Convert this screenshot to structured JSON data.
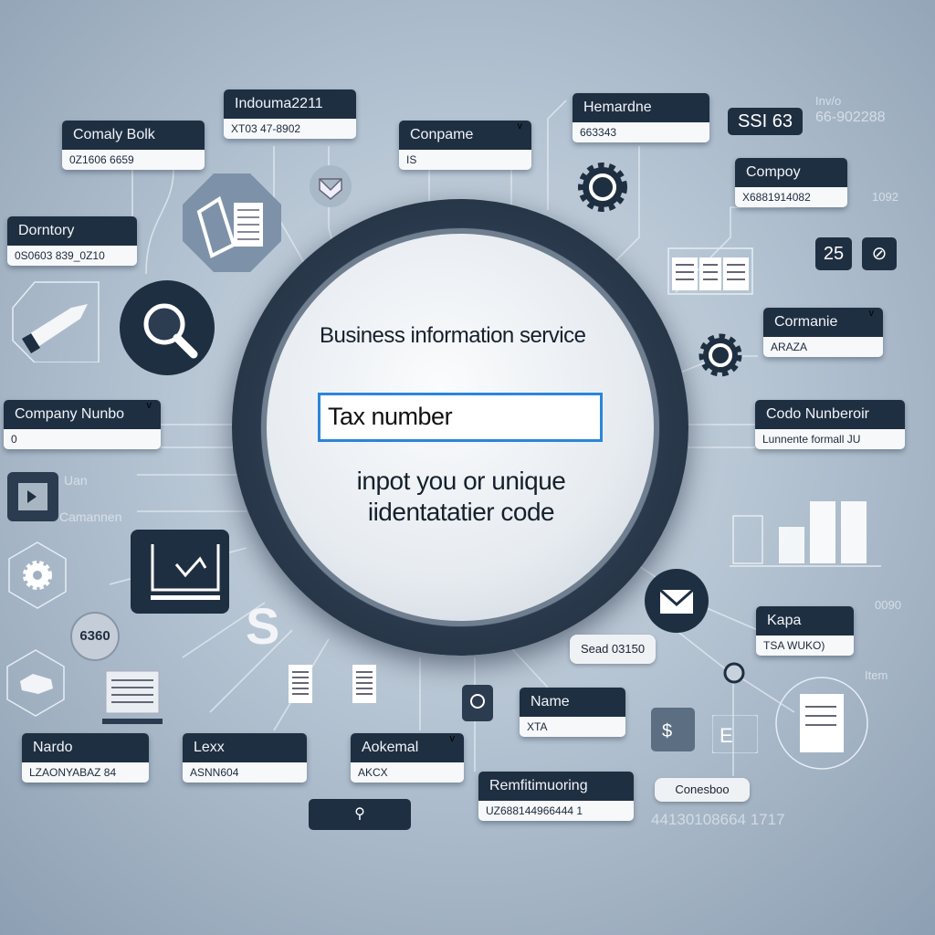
{
  "main": {
    "title": "Business information service",
    "input_value": "Tax number",
    "hint": "inpot you or unique iidentatatier code"
  },
  "cards": [
    {
      "label": "Comaly Bolk",
      "value": "0Z1606 6659"
    },
    {
      "label": "Indouma2211",
      "value": "XT03 47-8902"
    },
    {
      "label": "Conpame",
      "value": "IS",
      "chevron": "v"
    },
    {
      "label": "Hemardne",
      "value": "663343"
    },
    {
      "label": "Compoy",
      "value": "X6881914082"
    },
    {
      "label": "Dorntory",
      "value": "0S0603 839_0Z10"
    },
    {
      "label": "Cormanie",
      "value": "ARAZA",
      "chevron": "v"
    },
    {
      "label": "Company Nunbo",
      "value": "0",
      "chevron": "v"
    },
    {
      "label": "Codo Nunberoir",
      "value": "Lunnente formall JU"
    },
    {
      "label": "Kapa",
      "value": "TSA WUKO)"
    },
    {
      "label": "Name",
      "value": "XTA"
    },
    {
      "label": "Nardo",
      "value": "LZAONYABAZ 84"
    },
    {
      "label": "Lexx",
      "value": "ASNN604"
    },
    {
      "label": "Aokemal",
      "value": "AKCX",
      "chevron": "v"
    },
    {
      "label": "Remfitimuoring",
      "value": "UZ688144966444 1"
    }
  ],
  "badges": {
    "ssi": "SSI 63",
    "inv_label": "Inv/o",
    "inv_value": "66-902288",
    "code_6360": "6360",
    "z": "25"
  },
  "pills": {
    "sead": "Sead 03150",
    "conesboo": "Conesboo"
  },
  "texts": {
    "number": "44130108664 1717",
    "uan": "Uan",
    "camannen": "Camannen",
    "n1092": "1092",
    "n9690": "0090",
    "item": "Item"
  },
  "colors": {
    "card_header": "#1f2f42",
    "input_border": "#2b86d8",
    "background": "#b4c3d2"
  }
}
